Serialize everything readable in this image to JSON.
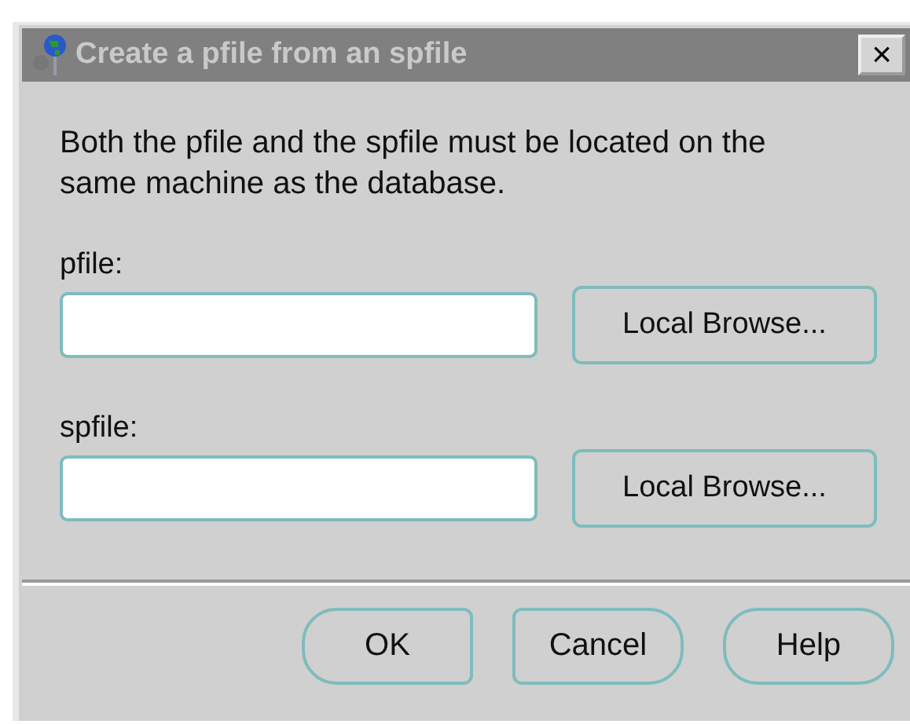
{
  "window": {
    "title": "Create a pfile from an spfile",
    "close": "×"
  },
  "message": "Both the pfile and the spfile must be located on the same machine as the database.",
  "fields": [
    {
      "label": "pfile:",
      "button": "Local Browse..."
    },
    {
      "label": "spfile:",
      "button": "Local Browse..."
    }
  ],
  "buttons": [
    {
      "label": "OK",
      "kind": "left"
    },
    {
      "label": "Cancel",
      "kind": "right"
    },
    {
      "label": "Help",
      "kind": "both"
    }
  ]
}
